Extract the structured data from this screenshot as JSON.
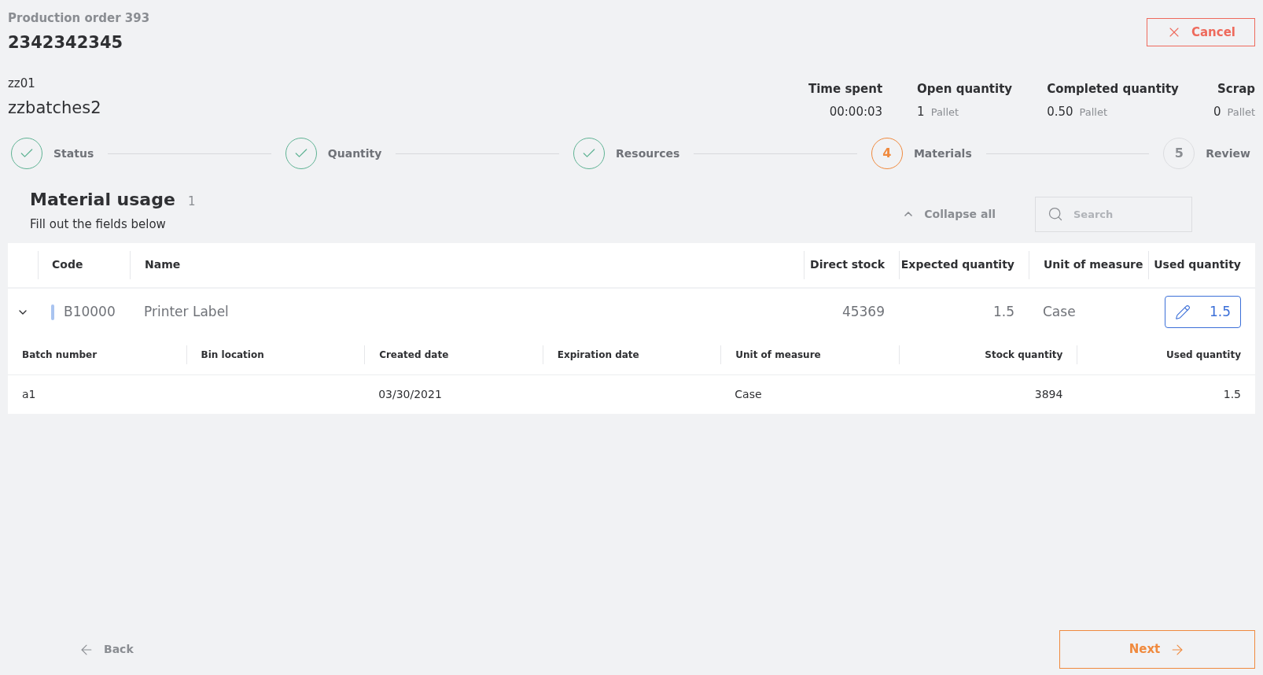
{
  "header": {
    "subtitle": "Production order 393",
    "title": "2342342345",
    "item_code": "zz01",
    "item_name": "zzbatches2"
  },
  "cancel_button": {
    "label": "Cancel"
  },
  "stats": [
    {
      "label": "Time spent",
      "value": "00:00:03"
    },
    {
      "label": "Open quantity",
      "value": "1",
      "unit": "Pallet"
    },
    {
      "label": "Completed quantity",
      "value": "0.50",
      "unit": "Pallet"
    },
    {
      "label": "Scrap",
      "value": "0",
      "unit": "Pallet"
    }
  ],
  "steps": [
    {
      "label": "Status",
      "done": true,
      "current": false
    },
    {
      "label": "Quantity",
      "done": true,
      "current": false
    },
    {
      "label": "Resources",
      "done": true,
      "current": false
    },
    {
      "label": "Materials",
      "done": false,
      "current": true,
      "number": "4"
    },
    {
      "label": "Review",
      "done": false,
      "current": false,
      "number": "5"
    }
  ],
  "section": {
    "title": "Material usage",
    "count": "1",
    "subtitle": "Fill out the fields below"
  },
  "collapse_all": {
    "label": "Collapse all"
  },
  "search": {
    "placeholder": "Search"
  },
  "table": {
    "columns": [
      "Code",
      "Name",
      "Direct stock",
      "Expected quantity",
      "Unit of measure",
      "Used quantity"
    ],
    "rows": [
      {
        "expanded": true,
        "color": "#a9c4f0",
        "code": "B10000",
        "name": "Printer Label",
        "direct_stock": "45369",
        "expected_quantity": "1.5",
        "unit": "Case",
        "used_quantity": "1.5",
        "batches": {
          "columns": [
            "Batch number",
            "Bin location",
            "Created date",
            "Expiration date",
            "Unit of measure",
            "Stock quantity",
            "Used quantity"
          ],
          "rows": [
            [
              "a1",
              "",
              "03/30/2021",
              "",
              "Case",
              "3894",
              "1.5"
            ]
          ]
        }
      }
    ]
  },
  "back_button": {
    "label": "Back"
  },
  "next_button": {
    "label": "Next"
  }
}
